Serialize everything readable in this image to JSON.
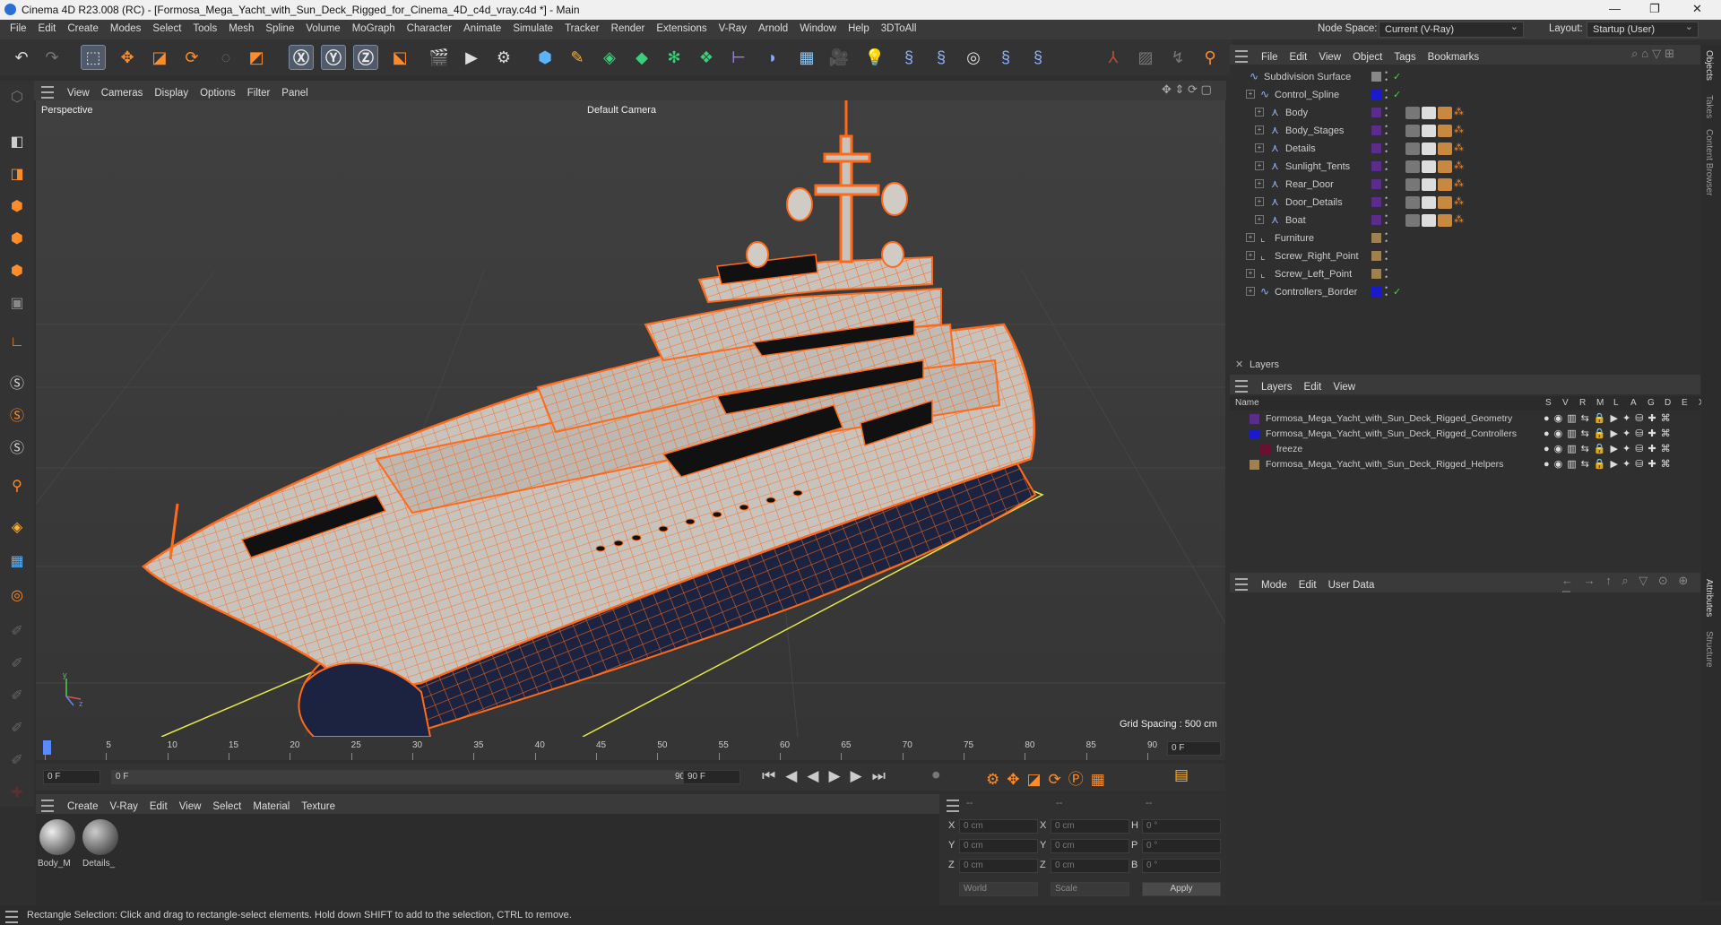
{
  "window": {
    "title": "Cinema 4D R23.008 (RC) - [Formosa_Mega_Yacht_with_Sun_Deck_Rigged_for_Cinema_4D_c4d_vray.c4d *] - Main"
  },
  "menubar": {
    "items": [
      "File",
      "Edit",
      "Create",
      "Modes",
      "Select",
      "Tools",
      "Mesh",
      "Spline",
      "Volume",
      "MoGraph",
      "Character",
      "Animate",
      "Simulate",
      "Tracker",
      "Render",
      "Extensions",
      "V-Ray",
      "Arnold",
      "Window",
      "Help",
      "3DToAll"
    ],
    "node_space_label": "Node Space:",
    "node_space_value": "Current (V-Ray)",
    "layout_label": "Layout:",
    "layout_value": "Startup (User)"
  },
  "viewport": {
    "menu": [
      "View",
      "Cameras",
      "Display",
      "Options",
      "Filter",
      "Panel"
    ],
    "label": "Perspective",
    "camera": "Default Camera",
    "grid_spacing": "Grid Spacing : 500 cm",
    "axis_y": "y",
    "axis_z": "z"
  },
  "timeline": {
    "ticks": [
      "0",
      "5",
      "10",
      "15",
      "20",
      "25",
      "30",
      "35",
      "40",
      "45",
      "50",
      "55",
      "60",
      "65",
      "70",
      "75",
      "80",
      "85",
      "90"
    ],
    "current_frame": "0 F"
  },
  "transport": {
    "start": "0 F",
    "range_start": "0 F",
    "range_end": "90 F",
    "end": "90 F"
  },
  "material_manager": {
    "menu": [
      "Create",
      "V-Ray",
      "Edit",
      "View",
      "Select",
      "Material",
      "Texture"
    ],
    "materials": [
      "Body_M",
      "Details_"
    ]
  },
  "coordinates": {
    "header": [
      "--",
      "--",
      "--"
    ],
    "rows": [
      {
        "axis": "X",
        "pos": "0 cm",
        "axis2": "X",
        "size": "0 cm",
        "axis3": "H",
        "rot": "0 °"
      },
      {
        "axis": "Y",
        "pos": "0 cm",
        "axis2": "Y",
        "size": "0 cm",
        "axis3": "P",
        "rot": "0 °"
      },
      {
        "axis": "Z",
        "pos": "0 cm",
        "axis2": "Z",
        "size": "0 cm",
        "axis3": "B",
        "rot": "0 °"
      }
    ],
    "world": "World",
    "scale": "Scale",
    "apply": "Apply"
  },
  "object_manager": {
    "menu": [
      "File",
      "Edit",
      "View",
      "Object",
      "Tags",
      "Bookmarks"
    ],
    "objects": [
      {
        "name": "Subdivision Surface",
        "indent": 0,
        "color": "#888888"
      },
      {
        "name": "Control_Spline",
        "indent": 1,
        "color": "#1a1acc"
      },
      {
        "name": "Body",
        "indent": 2,
        "color": "#5a2d8a"
      },
      {
        "name": "Body_Stages",
        "indent": 2,
        "color": "#5a2d8a"
      },
      {
        "name": "Details",
        "indent": 2,
        "color": "#5a2d8a"
      },
      {
        "name": "Sunlight_Tents",
        "indent": 2,
        "color": "#5a2d8a"
      },
      {
        "name": "Rear_Door",
        "indent": 2,
        "color": "#5a2d8a"
      },
      {
        "name": "Door_Details",
        "indent": 2,
        "color": "#5a2d8a"
      },
      {
        "name": "Boat",
        "indent": 2,
        "color": "#5a2d8a"
      },
      {
        "name": "Furniture",
        "indent": 1,
        "color": "#a08050"
      },
      {
        "name": "Screw_Right_Point",
        "indent": 1,
        "color": "#a08050"
      },
      {
        "name": "Screw_Left_Point",
        "indent": 1,
        "color": "#a08050"
      },
      {
        "name": "Controllers_Border",
        "indent": 1,
        "color": "#1a1acc"
      }
    ]
  },
  "layers": {
    "title": "Layers",
    "menu": [
      "Layers",
      "Edit",
      "View"
    ],
    "columns": [
      "Name",
      "S",
      "V",
      "R",
      "M",
      "L",
      "A",
      "G",
      "D",
      "E",
      "X"
    ],
    "items": [
      {
        "name": "Formosa_Mega_Yacht_with_Sun_Deck_Rigged_Geometry",
        "color": "#5a2d8a",
        "indent": 0
      },
      {
        "name": "Formosa_Mega_Yacht_with_Sun_Deck_Rigged_Controllers",
        "color": "#1a1acc",
        "indent": 0
      },
      {
        "name": "freeze",
        "color": "#6a1030",
        "indent": 1
      },
      {
        "name": "Formosa_Mega_Yacht_with_Sun_Deck_Rigged_Helpers",
        "color": "#a08050",
        "indent": 0
      }
    ]
  },
  "attributes": {
    "menu": [
      "Mode",
      "Edit",
      "User Data"
    ]
  },
  "side_tabs": [
    "Objects",
    "Takes",
    "Content Browser",
    "Attributes",
    "Structure"
  ],
  "status": "Rectangle Selection: Click and drag to rectangle-select elements. Hold down SHIFT to add to the selection, CTRL to remove.",
  "colors": {
    "accent": "#ff6a1a",
    "hull_dark": "#1b2340",
    "spline": "#e8e84a"
  }
}
